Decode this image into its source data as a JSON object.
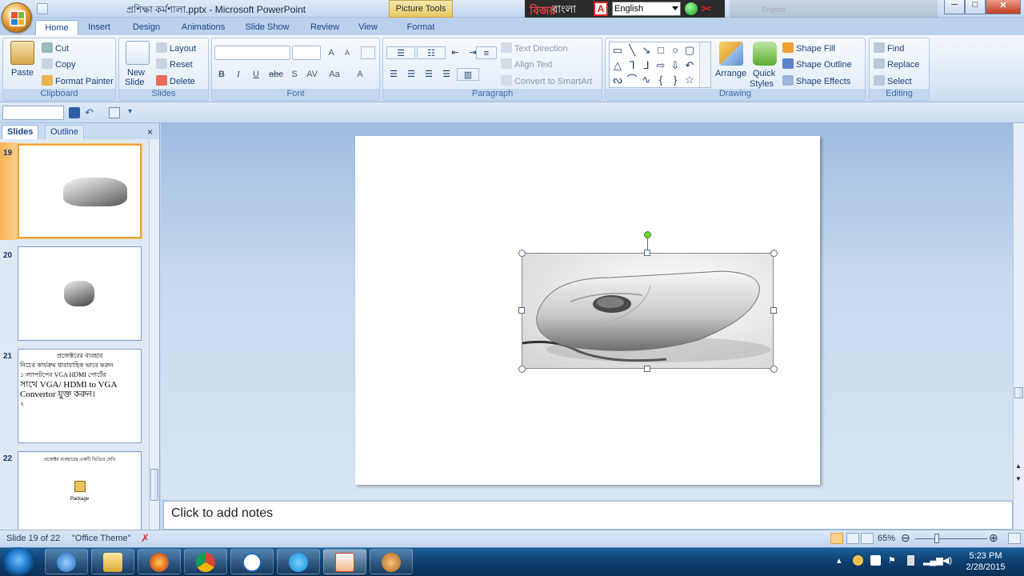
{
  "window": {
    "title": "প্রশিক্ষা কর্মশালা.pptx - Microsoft PowerPoint",
    "context_tab": "Picture Tools",
    "lang_logo": "বিজয়",
    "lang_label": "বাংলা",
    "lang_select": "English",
    "faded_lang": "English",
    "min": "─",
    "max": "□",
    "close": "✕"
  },
  "tabs": [
    "Home",
    "Insert",
    "Design",
    "Animations",
    "Slide Show",
    "Review",
    "View",
    "Format"
  ],
  "ribbon": {
    "clipboard": {
      "label": "Clipboard",
      "paste": "Paste",
      "cut": "Cut",
      "copy": "Copy",
      "format_painter": "Format Painter"
    },
    "slides": {
      "label": "Slides",
      "new_slide_1": "New",
      "new_slide_2": "Slide",
      "layout": "Layout",
      "reset": "Reset",
      "delete": "Delete"
    },
    "font": {
      "label": "Font",
      "bold": "B",
      "italic": "I",
      "underline": "U",
      "strike": "abc",
      "shadow": "S",
      "spacing": "AV",
      "case": "Aa",
      "color": "A",
      "grow": "A",
      "shrink": "A"
    },
    "paragraph": {
      "label": "Paragraph",
      "text_direction": "Text Direction",
      "align_text": "Align Text",
      "convert_smartart": "Convert to SmartArt"
    },
    "drawing": {
      "label": "Drawing",
      "arrange": "Arrange",
      "quick_styles_1": "Quick",
      "quick_styles_2": "Styles",
      "shape_fill": "Shape Fill",
      "shape_outline": "Shape Outline",
      "shape_effects": "Shape Effects"
    },
    "editing": {
      "label": "Editing",
      "find": "Find",
      "replace": "Replace",
      "select": "Select"
    }
  },
  "pane": {
    "slides_tab": "Slides",
    "outline_tab": "Outline",
    "close": "×"
  },
  "thumbnails": [
    {
      "num": "19"
    },
    {
      "num": "20"
    },
    {
      "num": "21",
      "title": "প্রজেক্টরের ব্যবহার",
      "line1": "নিচের কার্যক্রম ধারাবাহিক ভাবে করুন",
      "line2": "১ ল্যাপটপের VGA HDMI পোর্টের",
      "line3": "সাথে VGA/ HDMI to VGA",
      "line4": "Convertor যুক্ত করুন।",
      "line5": "২"
    },
    {
      "num": "22",
      "title": "প্রজেক্টর ব্যবহারের একটি ভিডিও দেখি",
      "package": "Package"
    }
  ],
  "notes": {
    "placeholder": "Click to add notes"
  },
  "status": {
    "slide_info": "Slide 19 of 22",
    "theme": "\"Office Theme\"",
    "zoom": "65%",
    "zoom_minus": "⊖",
    "zoom_plus": "⊕"
  },
  "taskbar": {
    "time": "5:23 PM",
    "date": "2/28/2015"
  }
}
